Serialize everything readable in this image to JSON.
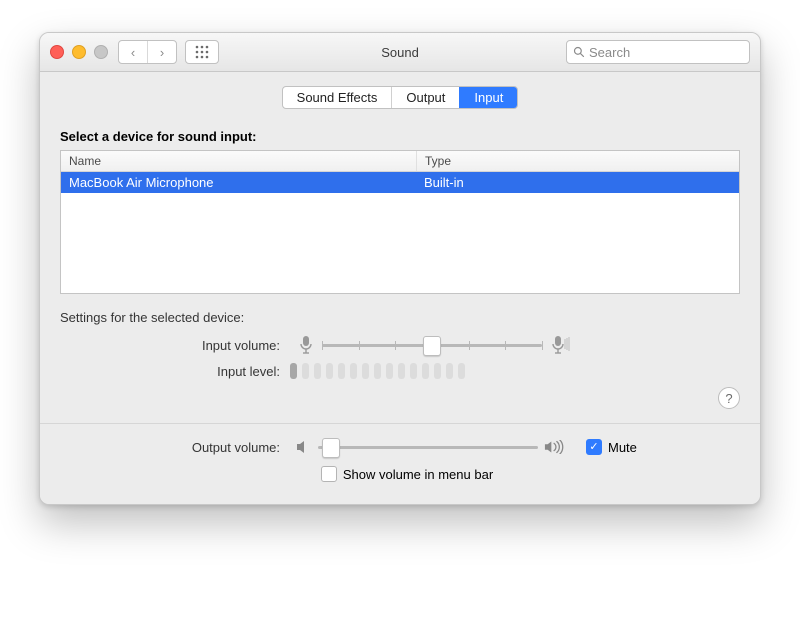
{
  "window": {
    "title": "Sound"
  },
  "toolbar": {
    "search_placeholder": "Search"
  },
  "tabs": {
    "t0": "Sound Effects",
    "t1": "Output",
    "t2": "Input",
    "active": 2
  },
  "section": {
    "select_label": "Select a device for sound input:",
    "col_name": "Name",
    "col_type": "Type",
    "row0_name": "MacBook Air Microphone",
    "row0_type": "Built-in"
  },
  "settings": {
    "header": "Settings for the selected device:",
    "input_volume_label": "Input volume:",
    "input_level_label": "Input level:",
    "input_volume_percent": 50,
    "input_level_active": 1,
    "input_level_total": 15
  },
  "footer": {
    "output_volume_label": "Output volume:",
    "output_volume_percent": 6,
    "mute_label": "Mute",
    "mute_checked": true,
    "menubar_label": "Show volume in menu bar",
    "menubar_checked": false
  },
  "help_label": "?"
}
